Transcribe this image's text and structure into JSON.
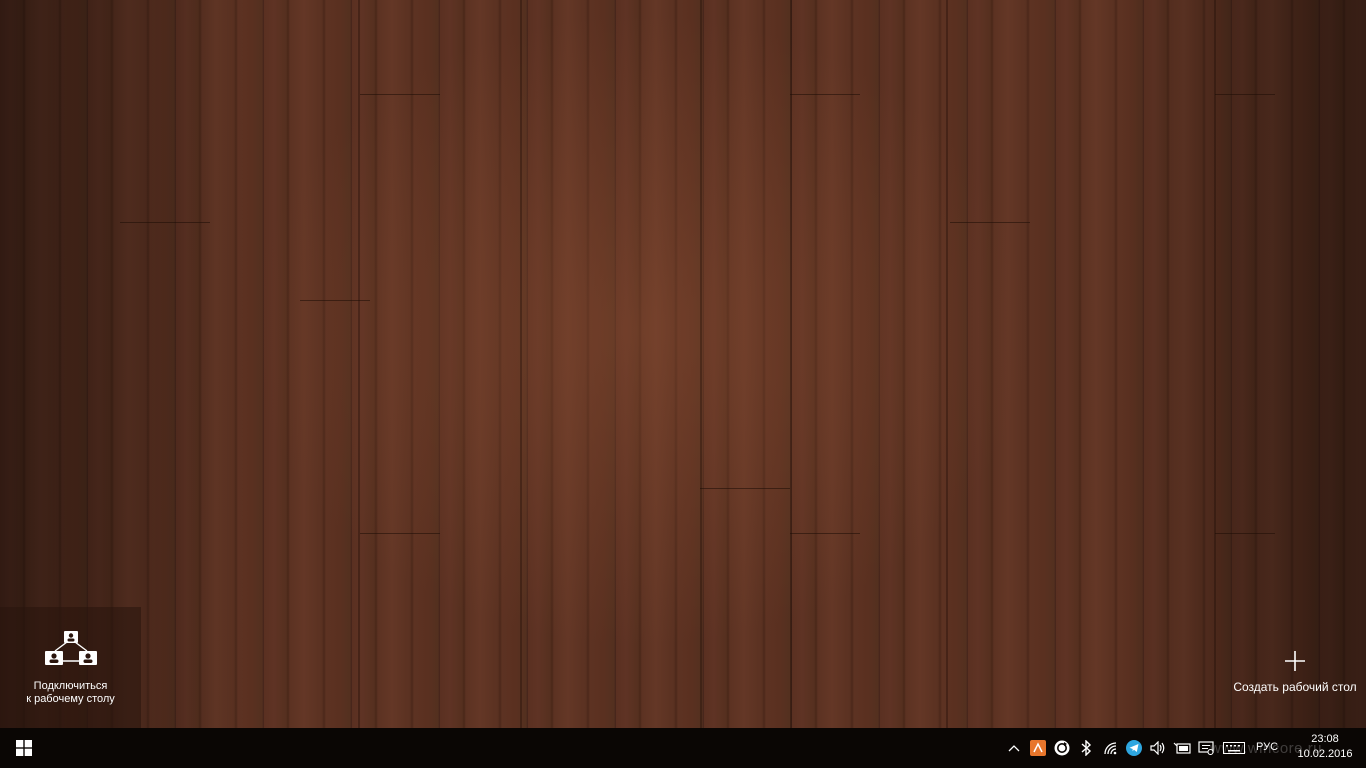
{
  "desktop": {
    "wallpaper": "dark wood planks",
    "connect_tile": {
      "label": "Подключиться\nк рабочему столу",
      "icon": "network-connect-icon"
    },
    "new_desktop": {
      "label": "Создать рабочий стол",
      "icon": "plus-icon"
    }
  },
  "taskbar": {
    "start_icon": "windows-logo-icon",
    "tray": {
      "icons": [
        "show-hidden-icons-chevron",
        "app-tray-icon",
        "sync-icon",
        "bluetooth-icon",
        "wifi-icon",
        "telegram-icon",
        "volume-icon",
        "battery-icon",
        "action-center-message-icon",
        "keyboard-icon"
      ],
      "language": "РУС",
      "time": "23:08",
      "date": "10.02.2016",
      "watermark": "www.wincore.ru"
    },
    "colors": {
      "background": "#0a0604",
      "accent_orange": "#e8762c",
      "telegram_blue": "#2ea6e0"
    }
  }
}
